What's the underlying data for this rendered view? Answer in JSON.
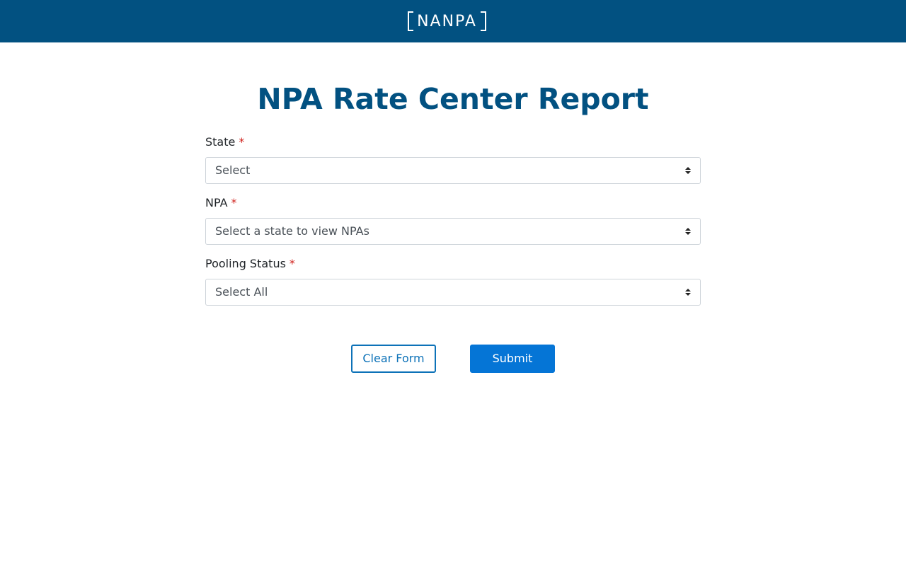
{
  "header": {
    "logo_text": "NANPA",
    "brand_color": "#025181"
  },
  "page": {
    "title": "NPA Rate Center Report"
  },
  "form": {
    "required_marker": "*",
    "state": {
      "label": "State",
      "value": "Select"
    },
    "npa": {
      "label": "NPA",
      "value": "Select a state to view NPAs"
    },
    "pooling_status": {
      "label": "Pooling Status",
      "value": "Select All"
    },
    "clear_label": "Clear Form",
    "submit_label": "Submit"
  },
  "colors": {
    "required": "#d0211c",
    "primary_button": "#0575d6",
    "outline_button": "#0d72b8"
  }
}
